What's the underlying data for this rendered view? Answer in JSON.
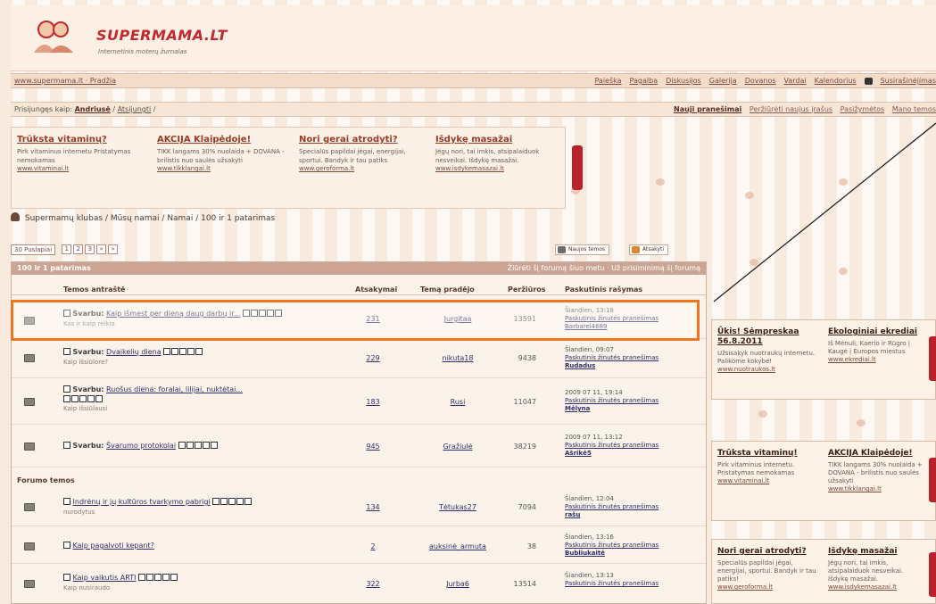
{
  "header": {
    "logo_title": "SUPERMAMA.LT",
    "logo_subtitle": "Internetinis moterų žurnalas"
  },
  "navbar": {
    "crumb": "www.supermama.lt · Pradžia",
    "menu": [
      "Paieška",
      "Pagalba",
      "Diskusijos",
      "Galerija",
      "Dovanos",
      "Vardai",
      "Kalendorius",
      "Susirašinėjimas"
    ]
  },
  "userbar": {
    "left_prefix": "Prisijungęs kaip:",
    "username": "Andriusė",
    "logout": "Atsijungti",
    "right_strong": "Nauji pranešimai",
    "right_links": [
      "Peržiūrėti naujus įrašus",
      "Pasižymėtos",
      "Mano temos"
    ]
  },
  "ads_top": [
    {
      "title": "Trūksta vitaminų?",
      "desc": "Pirk vitaminus internetu Pristatymas nemokamas",
      "url": "www.vitaminai.lt"
    },
    {
      "title": "AKCIJA Klaipėdoje!",
      "desc": "TIKK langams 30% nuolaida + DOVANA - brilistis nuo saulės užsakyti",
      "url": "www.tikklangai.lt"
    },
    {
      "title": "Nori gerai atrodyti?",
      "desc": "Specialūs papildai jėgai, energijai, sportui. Bandyk ir tau patiks",
      "url": "www.geroforma.lt"
    },
    {
      "title": "Išdykę masažai",
      "desc": "Jėgų nori, tai imkis, atsipalaiduok nesveikai. Išdykę masažai.",
      "url": "www.isdykemasazai.lt"
    }
  ],
  "breadcrumb": [
    "Supermamų klubas",
    "Mūsų namai",
    "Namai",
    "100 ir 1 patarimas"
  ],
  "pager": {
    "label": "30 Puslapiai",
    "pages": [
      "1",
      "2",
      "3",
      "»",
      "»"
    ]
  },
  "actions": {
    "new_topic": "Naujos temos",
    "reply": "Atsakyti"
  },
  "forum": {
    "title": "100 ir 1 patarimas",
    "head_right": "Žiūrėti šį forumą šiuo metu · Už prisiminimą šį forumą",
    "columns": {
      "topic": "Temos antraštė",
      "replies": "Atsakymai",
      "author": "Temą pradėjo",
      "views": "Peržiūros",
      "last": "Paskutinis rašymas"
    },
    "section_label": "Forumo temos",
    "rows": [
      {
        "prefix": "Svarbu:",
        "title": "Kaip išmest per dieną daug darbų ir...",
        "sub": "Kas ir kaip reikia",
        "replies": "231",
        "author": "Jurgitaa",
        "views": "13591",
        "last_date": "Šiandien, 13:18",
        "last_link": "Paskutinis žinutės pranešimas",
        "last_user": "Barbarel4689"
      },
      {
        "prefix": "Svarbu:",
        "title": "Dvaikelių diena",
        "sub": "Kaip išsiūlore?",
        "replies": "229",
        "author": "nikuta18",
        "views": "9438",
        "last_date": "Šiandien, 09:07",
        "last_link": "Paskutinis žinutės pranešimas",
        "last_user": "Rudadus"
      },
      {
        "prefix": "Svarbu:",
        "title": "Ruošus diena: foralai, lilijai, nuktėtai...",
        "sub": "Kaip išsiūlausi",
        "replies": "183",
        "author": "Rusi",
        "views": "11047",
        "last_date": "2009 07 11, 19:14",
        "last_link": "Paskutinis žinutės pranešimas",
        "last_user": "Mėlyna"
      },
      {
        "prefix": "Svarbu:",
        "title": "Švarumo protokolai",
        "sub": "",
        "replies": "945",
        "author": "Gražiulė",
        "views": "38219",
        "last_date": "2009 07 11, 13:12",
        "last_link": "Paskutinis žinutės pranešimas",
        "last_user": "Ašrikė5"
      },
      {
        "prefix": "",
        "title": "Indrėnų ir jų kultūros tvarkymo pabrigi",
        "sub": "nurodytus",
        "replies": "134",
        "author": "Tėtukas27",
        "views": "7094",
        "last_date": "Šiandien, 12:04",
        "last_link": "Paskutinis žinutės pranešimas",
        "last_user": "rašų"
      },
      {
        "prefix": "",
        "title": "Kaip pagalvoti kepant?",
        "sub": "",
        "replies": "2",
        "author": "auksinė_armuta",
        "views": "38",
        "last_date": "Šiandien, 13:16",
        "last_link": "Paskutinis žinutės pranešimas",
        "last_user": "Bubliukaitė"
      },
      {
        "prefix": "",
        "title": "Kaip vaikutis ARTI",
        "sub": "Kaip nusiraudo",
        "replies": "322",
        "author": "Jurba6",
        "views": "13514",
        "last_date": "Šiandien, 13:13",
        "last_link": "Paskutinis žinutės pranešimas",
        "last_user": ""
      }
    ]
  },
  "side_ads": [
    [
      {
        "title": "Ūkis! Sėmpreskaa 56.8.2011",
        "desc": "Užsisakyk nuotraukų internetu. Palikome kokybe!",
        "url": "www.nuotraukos.lt"
      },
      {
        "title": "Ekologiniai ekrediai",
        "desc": "Iš Mėnuli, Kaerio ir Rūgro į Kaugė į Europos miestus",
        "url": "www.ekrediai.lt"
      }
    ],
    [
      {
        "title": "Trūksta vitaminų!",
        "desc": "Pirk vitaminus internetu. Pristatymas nemokamas",
        "url": "www.vitaminai.lt"
      },
      {
        "title": "AKCIJA Klaipėdoje!",
        "desc": "TIKK langams 30% nuolaida + DOVANA - brilistis nuo saulės užsakyti",
        "url": "www.tikklangai.lt"
      }
    ],
    [
      {
        "title": "Nori gerai atrodyti?",
        "desc": "Specialūs papildai jėgai, energijai, sportui. Bandyk ir tau patiks!",
        "url": "www.geroforma.lt"
      },
      {
        "title": "Išdykę masažai",
        "desc": "Jėgų nori, tai imkis, atsipalaiduok nesveikai. Išdykę masažai.",
        "url": "www.isdykemasazai.lt"
      }
    ]
  ],
  "colors": {
    "highlight": "#f07521",
    "logo": "#c1292e",
    "ad_tab": "#b8232a"
  }
}
